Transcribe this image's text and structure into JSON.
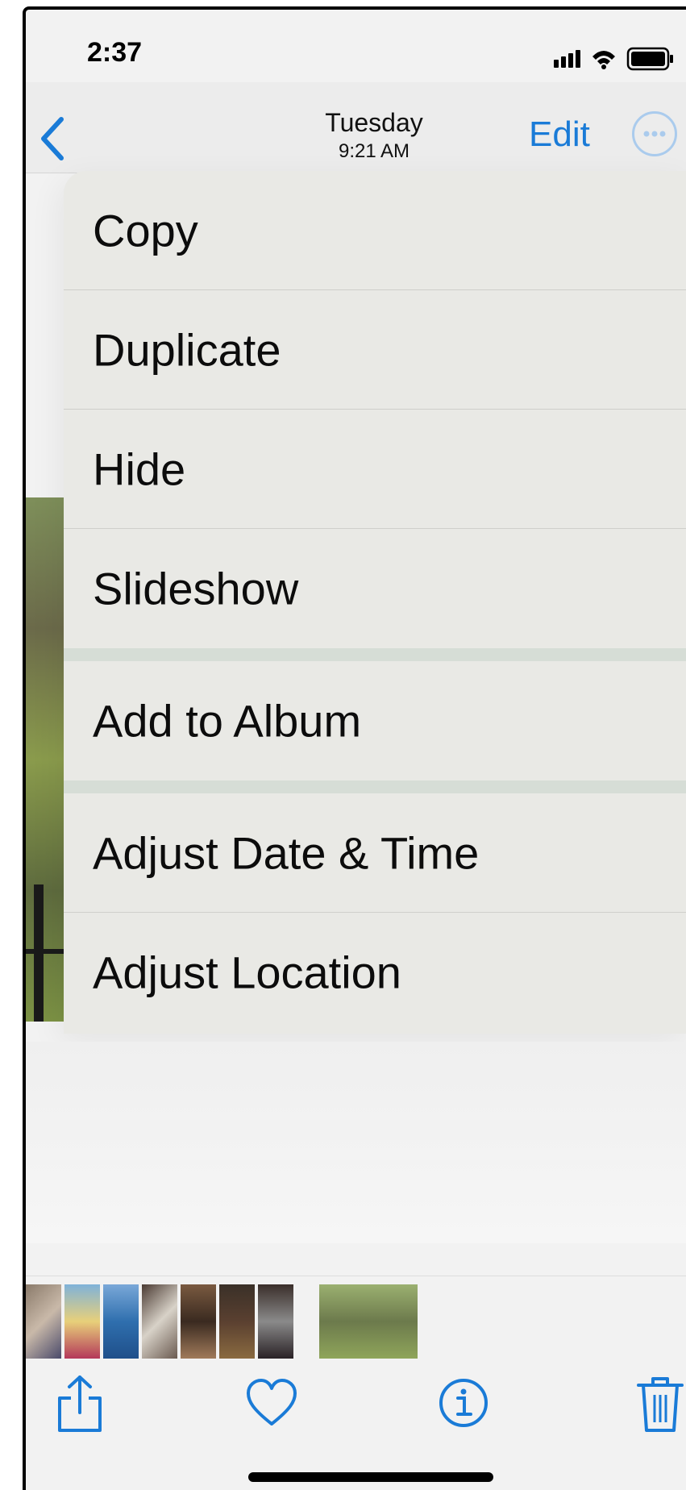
{
  "status_bar": {
    "time": "2:37"
  },
  "nav": {
    "title": "Tuesday",
    "subtitle": "9:21 AM",
    "edit_label": "Edit",
    "back_icon": "chevron-left-icon",
    "more_icon": "ellipsis-circle-icon"
  },
  "menu": {
    "items": [
      {
        "label": "Copy"
      },
      {
        "label": "Duplicate"
      },
      {
        "label": "Hide"
      },
      {
        "label": "Slideshow"
      },
      {
        "label": "Add to Album"
      },
      {
        "label": "Adjust Date & Time"
      },
      {
        "label": "Adjust Location"
      }
    ]
  },
  "toolbar": {
    "icons": [
      "share-icon",
      "heart-icon",
      "info-icon",
      "trash-icon"
    ]
  },
  "colors": {
    "accent": "#1a7bd7",
    "menu_bg": "#e9e9e5",
    "separator": "#d6ddd6"
  }
}
